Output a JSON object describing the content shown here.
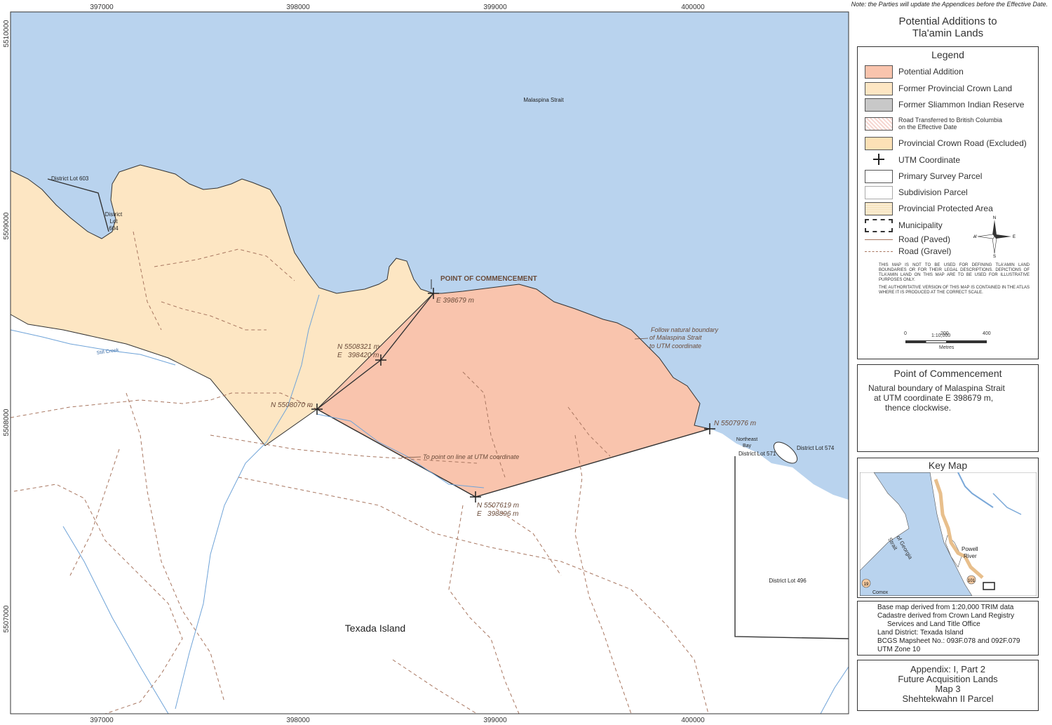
{
  "note": "Note:  the Parties will update the Appendices before the Effective Date.",
  "map": {
    "grid_x_labels": [
      "397000",
      "398000",
      "399000",
      "400000"
    ],
    "grid_y_labels": [
      "5510000",
      "5509000",
      "5508000",
      "5507000"
    ],
    "water_label": "Malaspina Strait",
    "island_label": "Texada Island",
    "creek_label": "Still Creek",
    "lots": {
      "dl603": "District Lot 603",
      "dl604_a": "District",
      "dl604_b": "Lot",
      "dl604_c": "604",
      "dl574": "District Lot 574",
      "dl571": "District Lot 571",
      "dl496": "District Lot 496",
      "bay_a": "Northeast",
      "bay_b": "Bay"
    },
    "poc_label": "POINT OF COMMENCEMENT",
    "poc_e": "E 398679 m",
    "pt1_n": "N 5508321 m",
    "pt1_e": "E   398420 m",
    "pt2_n": "N 5508070 m",
    "pt3_n": "N 5507619 m",
    "pt3_e": "E   398896 m",
    "pt4_n": "N 5507976 m",
    "note_follow_1": "Follow natural boundary",
    "note_follow_2": "of Malaspina Strait",
    "note_follow_3": "to UTM coordinate",
    "note_point": "To point on line at UTM coordinate"
  },
  "title": {
    "line1": "Potential Additions to",
    "line2": "Tla'amin Lands"
  },
  "legend": {
    "title": "Legend",
    "items": [
      {
        "label": "Potential Addition",
        "color": "#f9c4ad"
      },
      {
        "label": "Former Provincial Crown Land",
        "color": "#fde6c3"
      },
      {
        "label": "Former Sliammon Indian Reserve",
        "color": "#c8c8c8"
      },
      {
        "label": "Road Transferred to British Columbia",
        "label2": "on the Effective Date",
        "color": "#f6d6d0"
      },
      {
        "label": "Provincial Crown Road (Excluded)",
        "color": "#fde1b6"
      },
      {
        "label": "UTM Coordinate"
      },
      {
        "label": "Primary Survey Parcel",
        "color": "#ffffff"
      },
      {
        "label": "Subdivision Parcel",
        "color": "#ffffff"
      },
      {
        "label": "Provincial Protected Area",
        "color": "#f6e4c0"
      },
      {
        "label": "Municipality"
      },
      {
        "label": "Road (Paved)"
      },
      {
        "label": "Road (Gravel)"
      }
    ],
    "compass": {
      "n": "N",
      "s": "S",
      "e": "E",
      "w": "W"
    },
    "disclaimer_1": "THIS MAP IS NOT TO BE USED FOR DEFINING TLA'AMIN LAND BOUNDARIES OR FOR THEIR LEGAL DESCRIPTIONS. DEPICTIONS OF TLA'AMIN LAND ON THIS MAP ARE TO BE USED FOR ILLUSTRATIVE PURPOSES ONLY.",
    "disclaimer_2": "THE AUTHORITATIVE VERSION OF THIS MAP IS CONTAINED IN THE ATLAS WHERE IT IS PRODUCED AT THE CORRECT SCALE.",
    "scale_ratio": "1:10,000",
    "scale_ticks": [
      "0",
      "200",
      "400"
    ],
    "scale_unit": "Metres"
  },
  "poc": {
    "title": "Point of Commencement",
    "line1": "Natural boundary of Malaspina Strait",
    "line2": "at UTM coordinate E 398679 m,",
    "line3": "thence clockwise."
  },
  "key_map": {
    "title": "Key Map",
    "strait_a": "Strait",
    "strait_b": "of Georgia",
    "town_a": "Powell",
    "town_b": "River",
    "hwy_101": "101",
    "hwy_19": "19",
    "comox": "Comox"
  },
  "source": {
    "lines": [
      "Base map derived from 1:20,000 TRIM data",
      "Cadastre derived from Crown Land Registry",
      "    Services and Land Title Office",
      "Land District: Texada Island",
      "BCGS Mapsheet No.: 093F.078 and 092F.079",
      "UTM Zone 10"
    ]
  },
  "appendix": {
    "line1": "Appendix:  I, Part 2",
    "line2": "Future Acquisition Lands",
    "line3": "Map 3",
    "line4": "Shehtekwahn II Parcel"
  }
}
